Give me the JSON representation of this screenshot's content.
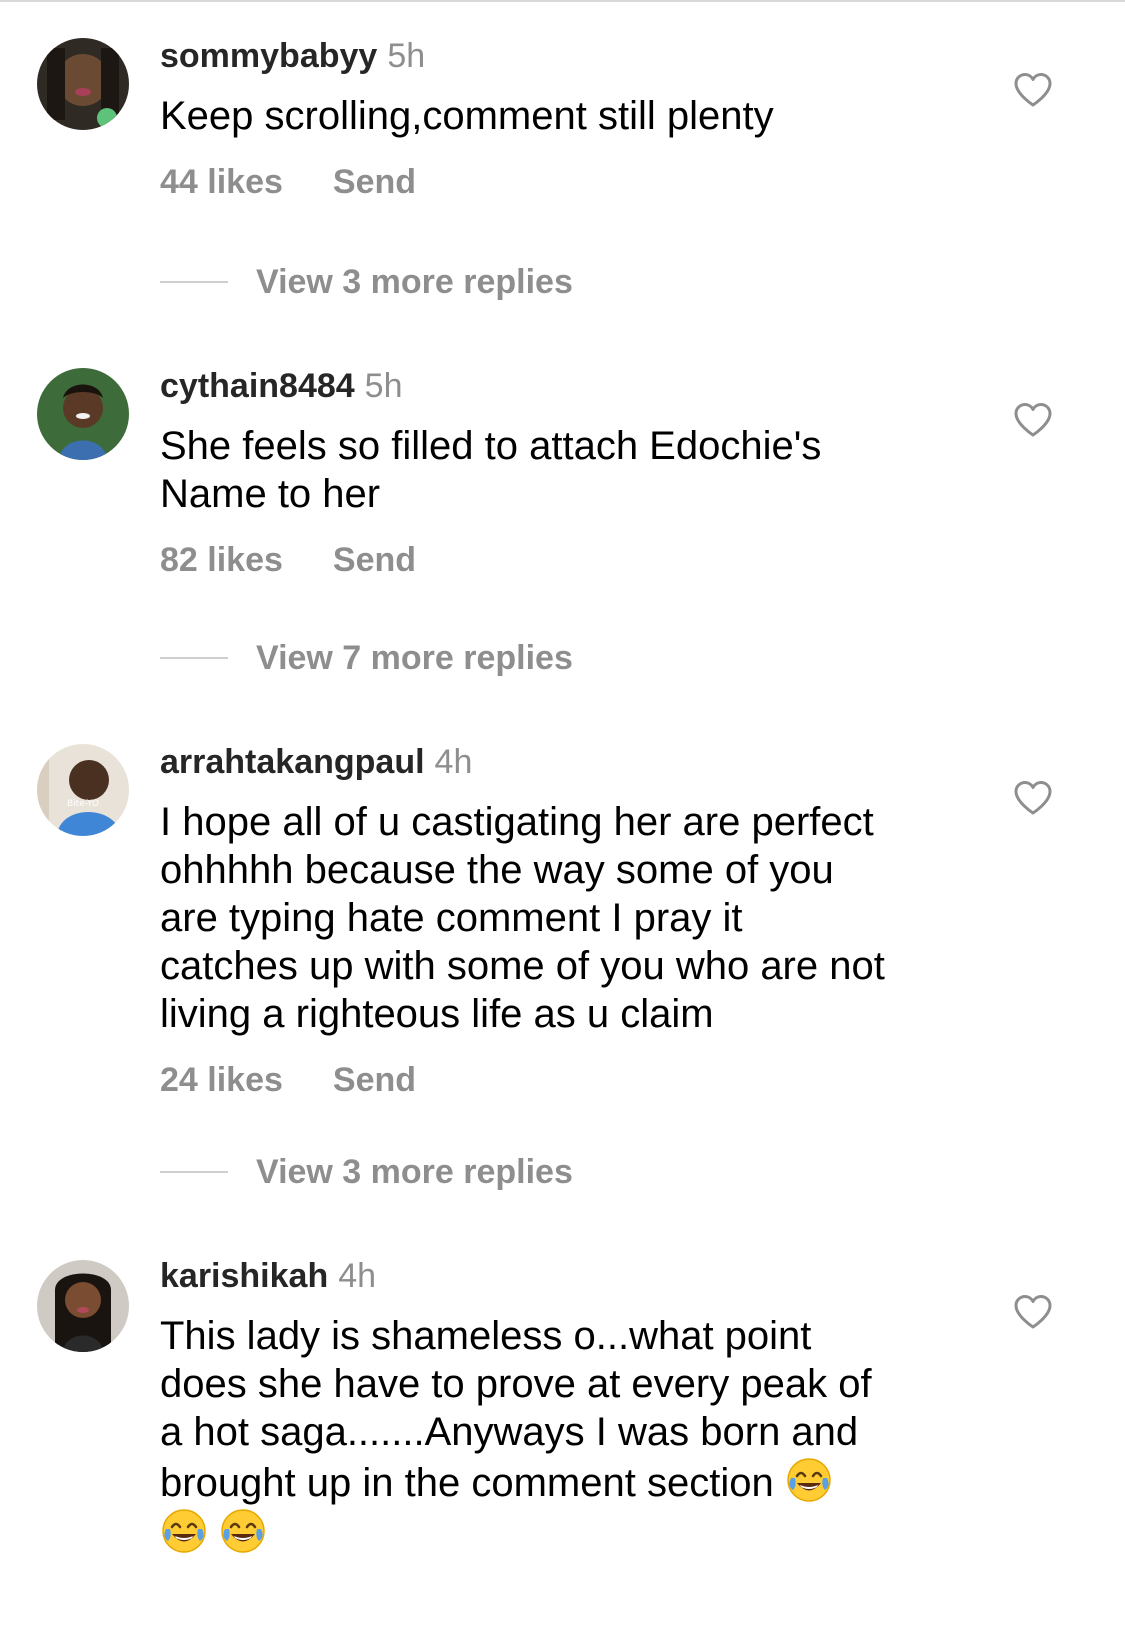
{
  "comments": [
    {
      "username": "sommybabyy",
      "time": "5h",
      "text": "Keep scrolling,comment still plenty",
      "likes": "44 likes",
      "send": "Send",
      "replies": "View 3 more replies"
    },
    {
      "username": "cythain8484",
      "time": "5h",
      "text": "She feels so filled to attach Edochie's\nName to her",
      "likes": "82 likes",
      "send": "Send",
      "replies": "View 7 more replies"
    },
    {
      "username": "arrahtakangpaul",
      "time": "4h",
      "text": "I hope all of u castigating her are perfect\nohhhhh because the way some of you\nare typing hate comment I pray it\ncatches up with some of you who are not\nliving a righteous life as u claim",
      "likes": "24 likes",
      "send": "Send",
      "replies": "View 3 more replies"
    },
    {
      "username": "karishikah",
      "time": "4h",
      "text": "This lady is shameless o...what point\ndoes she have to prove at every peak of\na hot saga.......Anyways I was born and\nbrought up in the comment section",
      "emoji": "face-with-tears-of-joy",
      "emoji_count": 3
    }
  ],
  "icons": {
    "like": "heart-outline-icon",
    "avatar_placeholder": "avatar"
  },
  "colors": {
    "username": "#262626",
    "meta_gray": "#8e8e8e",
    "divider": "#cfcfcf",
    "emoji_yellow": "#ffcc33",
    "tears_blue": "#5aa0e6"
  }
}
